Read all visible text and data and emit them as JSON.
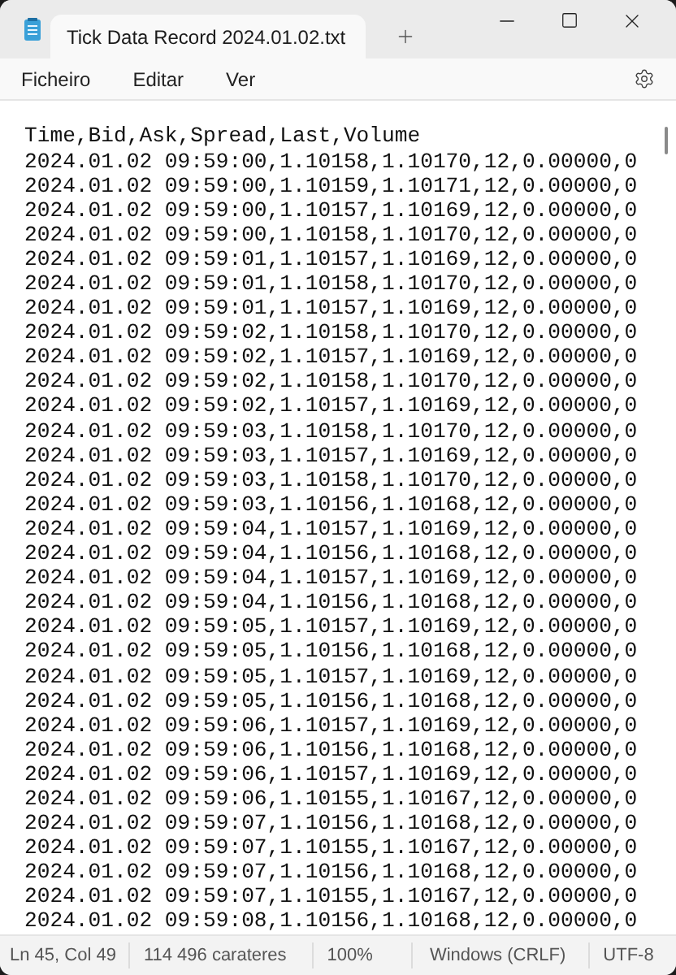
{
  "window": {
    "title": "Tick Data Record 2024.01.02.txt"
  },
  "menu": [
    "Ficheiro",
    "Editar",
    "Ver"
  ],
  "lines": [
    "Time,Bid,Ask,Spread,Last,Volume",
    "2024.01.02 09:59:00,1.10158,1.10170,12,0.00000,0",
    "2024.01.02 09:59:00,1.10159,1.10171,12,0.00000,0",
    "2024.01.02 09:59:00,1.10157,1.10169,12,0.00000,0",
    "2024.01.02 09:59:00,1.10158,1.10170,12,0.00000,0",
    "2024.01.02 09:59:01,1.10157,1.10169,12,0.00000,0",
    "2024.01.02 09:59:01,1.10158,1.10170,12,0.00000,0",
    "2024.01.02 09:59:01,1.10157,1.10169,12,0.00000,0",
    "2024.01.02 09:59:02,1.10158,1.10170,12,0.00000,0",
    "2024.01.02 09:59:02,1.10157,1.10169,12,0.00000,0",
    "2024.01.02 09:59:02,1.10158,1.10170,12,0.00000,0",
    "2024.01.02 09:59:02,1.10157,1.10169,12,0.00000,0",
    "2024.01.02 09:59:03,1.10158,1.10170,12,0.00000,0",
    "2024.01.02 09:59:03,1.10157,1.10169,12,0.00000,0",
    "2024.01.02 09:59:03,1.10158,1.10170,12,0.00000,0",
    "2024.01.02 09:59:03,1.10156,1.10168,12,0.00000,0",
    "2024.01.02 09:59:04,1.10157,1.10169,12,0.00000,0",
    "2024.01.02 09:59:04,1.10156,1.10168,12,0.00000,0",
    "2024.01.02 09:59:04,1.10157,1.10169,12,0.00000,0",
    "2024.01.02 09:59:04,1.10156,1.10168,12,0.00000,0",
    "2024.01.02 09:59:05,1.10157,1.10169,12,0.00000,0",
    "2024.01.02 09:59:05,1.10156,1.10168,12,0.00000,0",
    "2024.01.02 09:59:05,1.10157,1.10169,12,0.00000,0",
    "2024.01.02 09:59:05,1.10156,1.10168,12,0.00000,0",
    "2024.01.02 09:59:06,1.10157,1.10169,12,0.00000,0",
    "2024.01.02 09:59:06,1.10156,1.10168,12,0.00000,0",
    "2024.01.02 09:59:06,1.10157,1.10169,12,0.00000,0",
    "2024.01.02 09:59:06,1.10155,1.10167,12,0.00000,0",
    "2024.01.02 09:59:07,1.10156,1.10168,12,0.00000,0",
    "2024.01.02 09:59:07,1.10155,1.10167,12,0.00000,0",
    "2024.01.02 09:59:07,1.10156,1.10168,12,0.00000,0",
    "2024.01.02 09:59:07,1.10155,1.10167,12,0.00000,0",
    "2024.01.02 09:59:08,1.10156,1.10168,12,0.00000,0"
  ],
  "status_bar": [
    "Ln 45, Col 49",
    "114 496 carateres",
    "100%",
    "Windows (CRLF)",
    "UTF-8"
  ]
}
